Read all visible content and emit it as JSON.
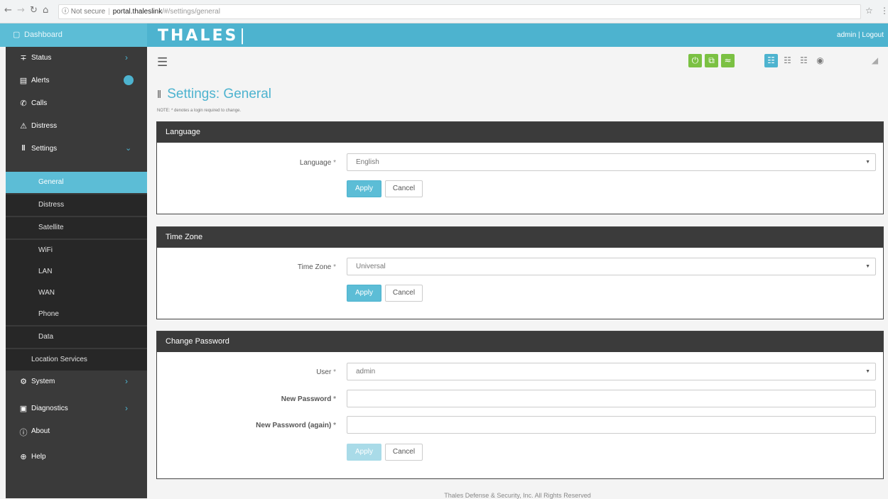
{
  "browser": {
    "not_secure": "Not secure",
    "host": "portal.thaleslink",
    "path": "/#/settings/general"
  },
  "header": {
    "dashboard": "Dashboard",
    "logo": "THALES",
    "user_links": "admin | Logout"
  },
  "sidebar": {
    "items": [
      {
        "label": "Status",
        "icon": "bar-chart-icon"
      },
      {
        "label": "Alerts",
        "icon": "calendar-icon"
      },
      {
        "label": "Calls",
        "icon": "phone-icon"
      },
      {
        "label": "Distress",
        "icon": "warning-icon"
      },
      {
        "label": "Settings",
        "icon": "columns-icon"
      }
    ],
    "sub_items": [
      "General",
      "Distress",
      "Satellite",
      "WiFi",
      "LAN",
      "WAN",
      "Phone",
      "Data",
      "Location Services"
    ],
    "bottom_items": [
      {
        "label": "System",
        "icon": "gear-icon"
      },
      {
        "label": "Diagnostics",
        "icon": "toolbox-icon"
      },
      {
        "label": "About",
        "icon": "info-icon"
      },
      {
        "label": "Help",
        "icon": "lifebuoy-icon"
      }
    ]
  },
  "page": {
    "title": "Settings: General",
    "note": "NOTE: * denotes a login required to change."
  },
  "language_panel": {
    "heading": "Language",
    "label": "Language",
    "required_mark": "*",
    "value": "English",
    "apply": "Apply",
    "cancel": "Cancel"
  },
  "timezone_panel": {
    "heading": "Time Zone",
    "label": "Time Zone",
    "required_mark": "*",
    "value": "Universal",
    "apply": "Apply",
    "cancel": "Cancel"
  },
  "password_panel": {
    "heading": "Change Password",
    "user_label": "User",
    "user_value": "admin",
    "new_label": "New Password",
    "again_label": "New Password (again)",
    "required_mark": "*",
    "apply": "Apply",
    "cancel": "Cancel"
  },
  "footer": "Thales Defense & Security, Inc. All Rights Reserved",
  "colors": {
    "accent": "#4db3cf",
    "status_green": "#7bc143",
    "sidebar": "#3a3a3a"
  }
}
